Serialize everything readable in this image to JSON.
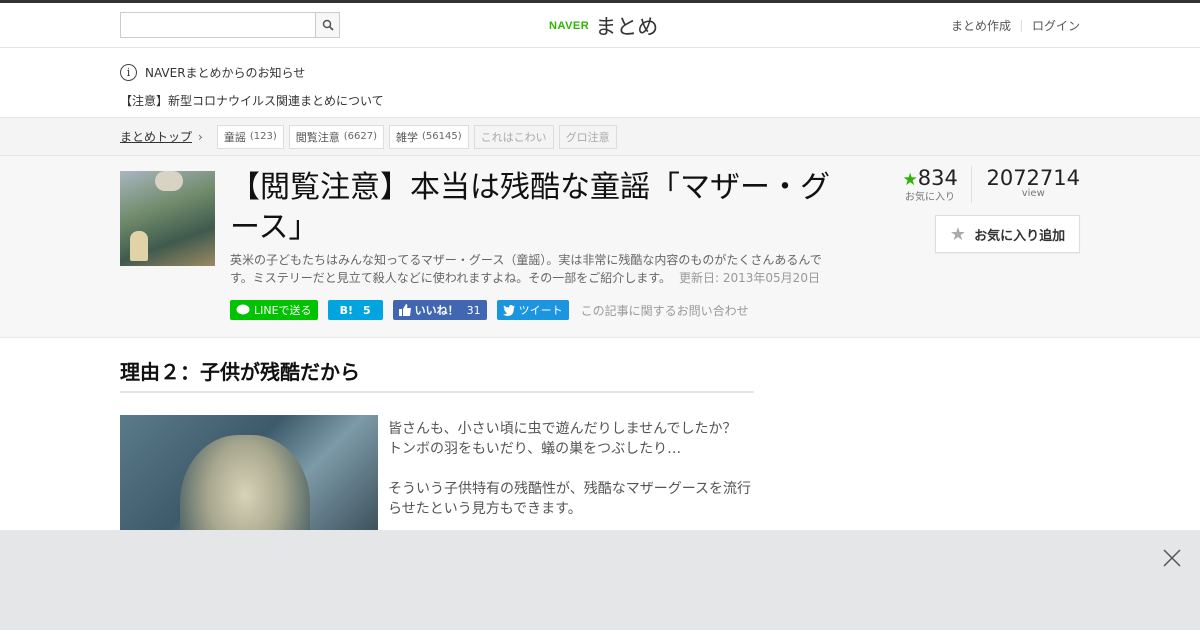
{
  "header": {
    "search_placeholder": "",
    "brand_naver": "NAVER",
    "brand_matome": "まとめ",
    "link_create": "まとめ作成",
    "link_login": "ログイン"
  },
  "notice": {
    "title": "NAVERまとめからのお知らせ",
    "item": "【注意】新型コロナウイルス関連まとめについて"
  },
  "breadcrumb": {
    "home": "まとめトップ",
    "tags": [
      {
        "label": "童謡",
        "count": "(123)"
      },
      {
        "label": "閲覧注意",
        "count": "(6627)"
      },
      {
        "label": "雑学",
        "count": "(56145)"
      },
      {
        "label": "これはこわい",
        "count": ""
      },
      {
        "label": "グロ注意",
        "count": ""
      }
    ]
  },
  "article": {
    "title": "【閲覧注意】本当は残酷な童謡「マザー・グース」",
    "description": "英米の子どもたちはみんな知ってるマザー・グース（童謡）。実は非常に残酷な内容のものがたくさんあるんです。ミステリーだと見立て殺人などに使われますよね。その一部をご紹介します。",
    "updated": "更新日: 2013年05月20日",
    "fav_count": "834",
    "fav_label": "お気に入り",
    "view_count": "2072714",
    "view_label": "view",
    "fav_button": "お気に入り追加"
  },
  "share": {
    "line": "LINEで送る",
    "hatena": "B!",
    "hatena_count": "5",
    "facebook": "いいね！",
    "facebook_count": "31",
    "tweet": "ツイート",
    "inquiry": "この記事に関するお問い合わせ"
  },
  "section": {
    "heading": "理由２：子供が残酷だから",
    "para1_line1": "皆さんも、小さい頃に虫で遊んだりしませんでしたか？",
    "para1_line2": "トンボの羽をもいだり、蟻の巣をつぶしたり…",
    "para2_line1": "そういう子供特有の残酷性が、残酷なマザーグースを流行",
    "para2_line2": "らせたという見方もできます。"
  }
}
